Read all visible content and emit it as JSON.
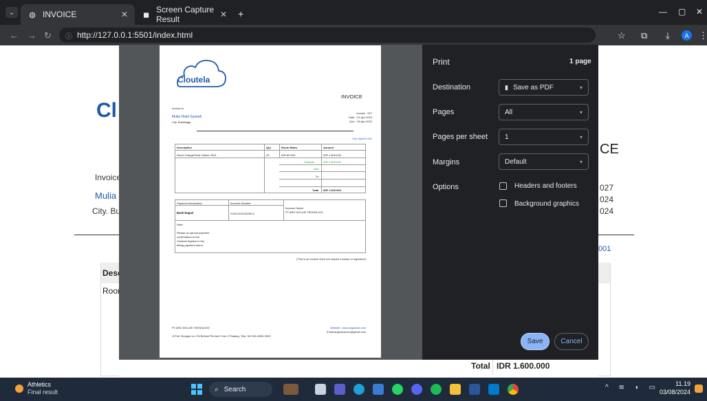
{
  "browser": {
    "tabs": [
      {
        "label": "INVOICE",
        "active": true
      },
      {
        "label": "Screen Capture Result",
        "active": false
      }
    ],
    "url": "http://127.0.0.1:5501/index.html",
    "profile_initial": "A"
  },
  "background_page": {
    "logo_partial": "Cl",
    "title_partial": "CE",
    "invoice_to_partial": "Invoice",
    "customer_partial": "Mulia",
    "city_partial": "City. Bu",
    "right_numbers": [
      "027",
      "024",
      "024"
    ],
    "ref_partial": "001",
    "table_desc_partial": "Desc",
    "row_partial": "Roor",
    "total_label": "Total",
    "total_value": "IDR 1.600.000"
  },
  "invoice": {
    "brand": "Cloutela",
    "title": "INVOICE",
    "invoice_to_label": "Invoice to",
    "customer": "Mulia Hotel Syariah",
    "city": "City. Bukittinggi",
    "invoice_no": "Invoice : 027",
    "date": "Date : 01-Apr-2024",
    "due": "Due : 15-Apr-2024",
    "ref": "Clou Mia ID 001",
    "headers": [
      "Description",
      "Qty",
      "Room Rates",
      "Amount"
    ],
    "row": [
      "Room Charge/Sold: March 2024",
      "20",
      "IDR 80.000",
      "IDR 1.600.000"
    ],
    "subtotal_label": "Subtotal",
    "subtotal_value": "IDR 1.600.000",
    "disc_label": "Disc",
    "disc_value": "-",
    "tax_label": "Tax",
    "tax_value": "-",
    "total_label": "Total",
    "total_value": "IDR 1.600.000",
    "payment_label": "Payment Information",
    "bank_name": "Bank Nagari",
    "account_number_label": "Account Number",
    "account_number": "2100.0103.00200-6",
    "account_name_label": "Account Name",
    "account_name": "PT.ARG SOLUSI TEKNOLOGI",
    "note_title": "Note:",
    "note_lines": [
      "Please do upload payment",
      "confirmation to the",
      "Cloutela System in the",
      "billing payment menu"
    ],
    "stamp_note": "(This is an invoice does not require a stamp or signature)",
    "company": "PT.ARG SOLUSI TEKNOLOGI",
    "address": "Jl.Prof. Bungau no 17b Belumt Permai 2 Kav 2 Padang- Telp +62 831-8300-0000",
    "website": "Website : www.argsolusi.com",
    "email": "Email:argsolusicom@gmail.com"
  },
  "print": {
    "title": "Print",
    "page_count": "1 page",
    "destination_label": "Destination",
    "destination_value": "Save as PDF",
    "pages_label": "Pages",
    "pages_value": "All",
    "pps_label": "Pages per sheet",
    "pps_value": "1",
    "margins_label": "Margins",
    "margins_value": "Default",
    "options_label": "Options",
    "opt_headers": "Headers and footers",
    "opt_background": "Background graphics",
    "save": "Save",
    "cancel": "Cancel"
  },
  "taskbar": {
    "weather_title": "Athletics",
    "weather_sub": "Final result",
    "search": "Search",
    "time": "11.19",
    "date": "03/08/2024"
  },
  "colors": {
    "accent": "#8ab4f8",
    "brand": "#1e5aa8",
    "green": "#2e9b3c"
  }
}
